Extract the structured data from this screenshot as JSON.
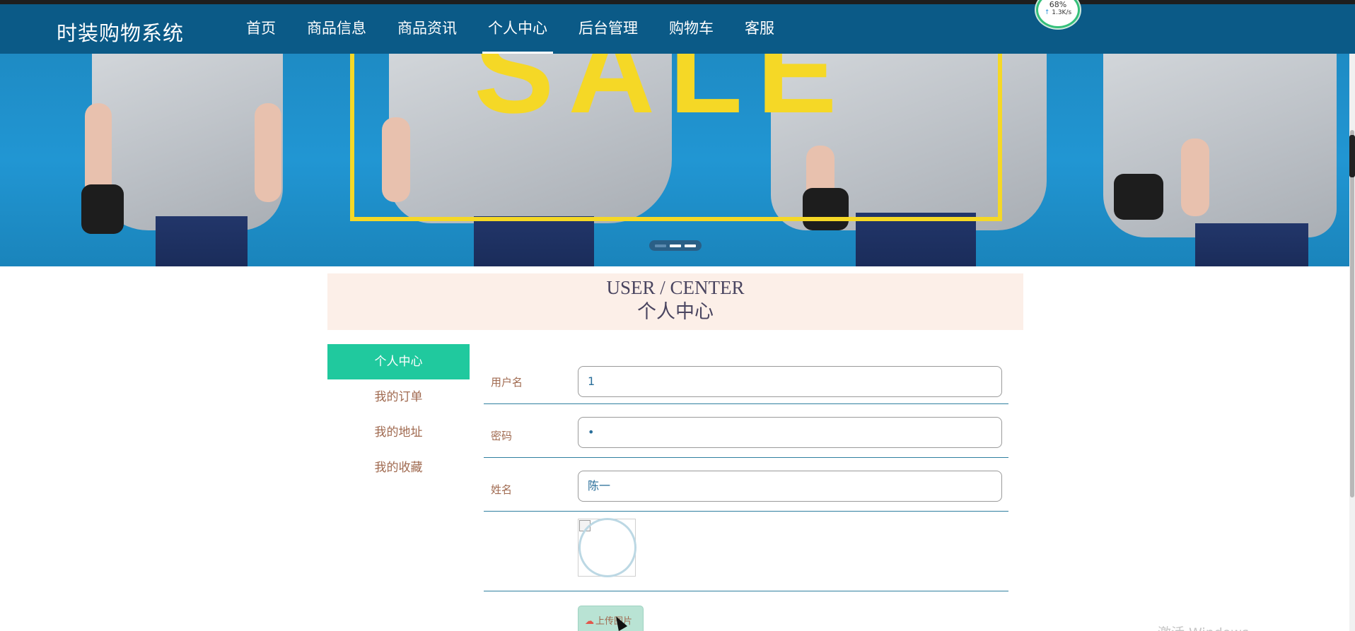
{
  "app": {
    "title": "时装购物系统"
  },
  "nav": {
    "items": [
      {
        "label": "首页"
      },
      {
        "label": "商品信息"
      },
      {
        "label": "商品资讯"
      },
      {
        "label": "个人中心"
      },
      {
        "label": "后台管理"
      },
      {
        "label": "购物车"
      },
      {
        "label": "客服"
      }
    ],
    "active": "个人中心"
  },
  "speed_widget": {
    "percent": "68%",
    "upload_speed": "1.3K/s"
  },
  "banner": {
    "text": "SALE",
    "slides": 3,
    "active_slide": 1
  },
  "section": {
    "title_en": "USER / CENTER",
    "title_cn": "个人中心"
  },
  "sidebar": {
    "items": [
      {
        "label": "个人中心"
      },
      {
        "label": "我的订单"
      },
      {
        "label": "我的地址"
      },
      {
        "label": "我的收藏"
      }
    ],
    "active": "个人中心"
  },
  "form": {
    "username": {
      "label": "用户名",
      "value": "1"
    },
    "password": {
      "label": "密码",
      "value": "•"
    },
    "name": {
      "label": "姓名",
      "value": "陈一"
    },
    "upload_button": "上传图片"
  },
  "watermark": "激活 Windows",
  "colors": {
    "nav_bg": "#0b5a87",
    "accent": "#20c99e",
    "header_bg": "#fcefe8",
    "banner_yellow": "#f5d826",
    "label_brown": "#a06a50"
  }
}
